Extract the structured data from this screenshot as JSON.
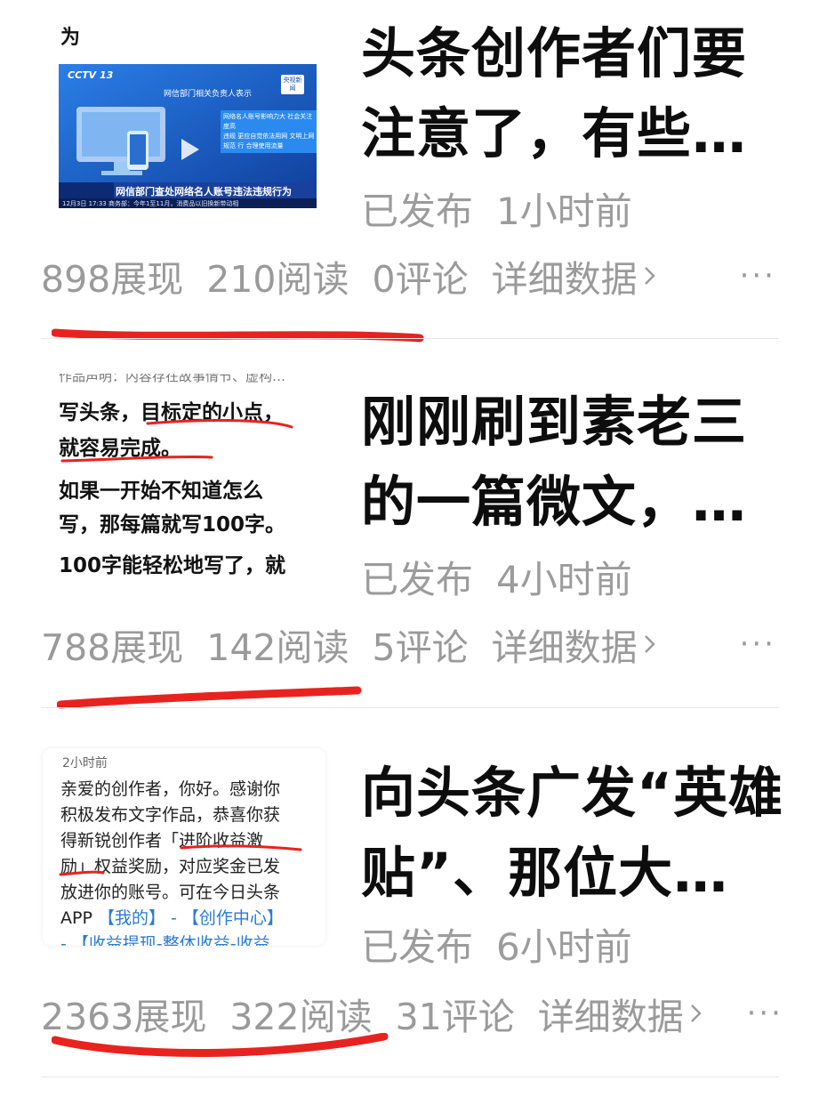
{
  "items": [
    {
      "thumb": {
        "top_char": "为",
        "logo_text": "CCTV 13",
        "banner_top": "网信部门相关负责人表示",
        "badge": "央视新闻",
        "blue_lines": [
          "网络名人账号影响力大 社会关注度高",
          "违规 更应自觉依法用网 文明上网",
          "规范 行 合理使用流量"
        ],
        "caption": "网信部门查处网络名人账号违法违规行为",
        "ticker": "12月3日 17:33   商务部：今年1至11月，消费品以旧换新带动相"
      },
      "title": "头条创作者们要注意了，有些…",
      "status": "已发布",
      "time": "1小时前",
      "impressions": "898展现",
      "reads": "210阅读",
      "comments": "0评论",
      "detail": "详细数据",
      "more": "···"
    },
    {
      "thumb": {
        "top_line": "作品声明：内容存在故事情节、虚构…",
        "lines": [
          "写头条，目标定的小点，",
          "就容易完成。",
          "如果一开始不知道怎么",
          "写，那每篇就写100字。",
          "100字能轻松地写了，就"
        ]
      },
      "title": "刚刚刷到素老三的一篇微文，…",
      "status": "已发布",
      "time": "4小时前",
      "impressions": "788展现",
      "reads": "142阅读",
      "comments": "5评论",
      "detail": "详细数据",
      "more": "···"
    },
    {
      "thumb": {
        "top_line": "2小时前",
        "lines": [
          "亲爱的创作者，你好。感谢你",
          "积极发布文字作品，恭喜你获",
          "得新锐创作者「进阶收益激",
          "励」权益奖励，对应奖金已发",
          "放进你的账号。可在今日头条"
        ],
        "blue_line1_prefix": "APP",
        "blue_line1": "【我的】 - 【创作中心】",
        "blue_line2": "- 【收益提现-整体收益-收益"
      },
      "title": "向头条广发“英雄贴”、那位大…",
      "status": "已发布",
      "time": "6小时前",
      "impressions": "2363展现",
      "reads": "322阅读",
      "comments": "31评论",
      "detail": "详细数据",
      "more": "···"
    }
  ],
  "colors": {
    "underline": "#e8231f",
    "gray": "#9a9a9a",
    "link_blue": "#2a7bd5"
  },
  "icons": [
    "chevron-right-icon",
    "more-dots-icon"
  ]
}
